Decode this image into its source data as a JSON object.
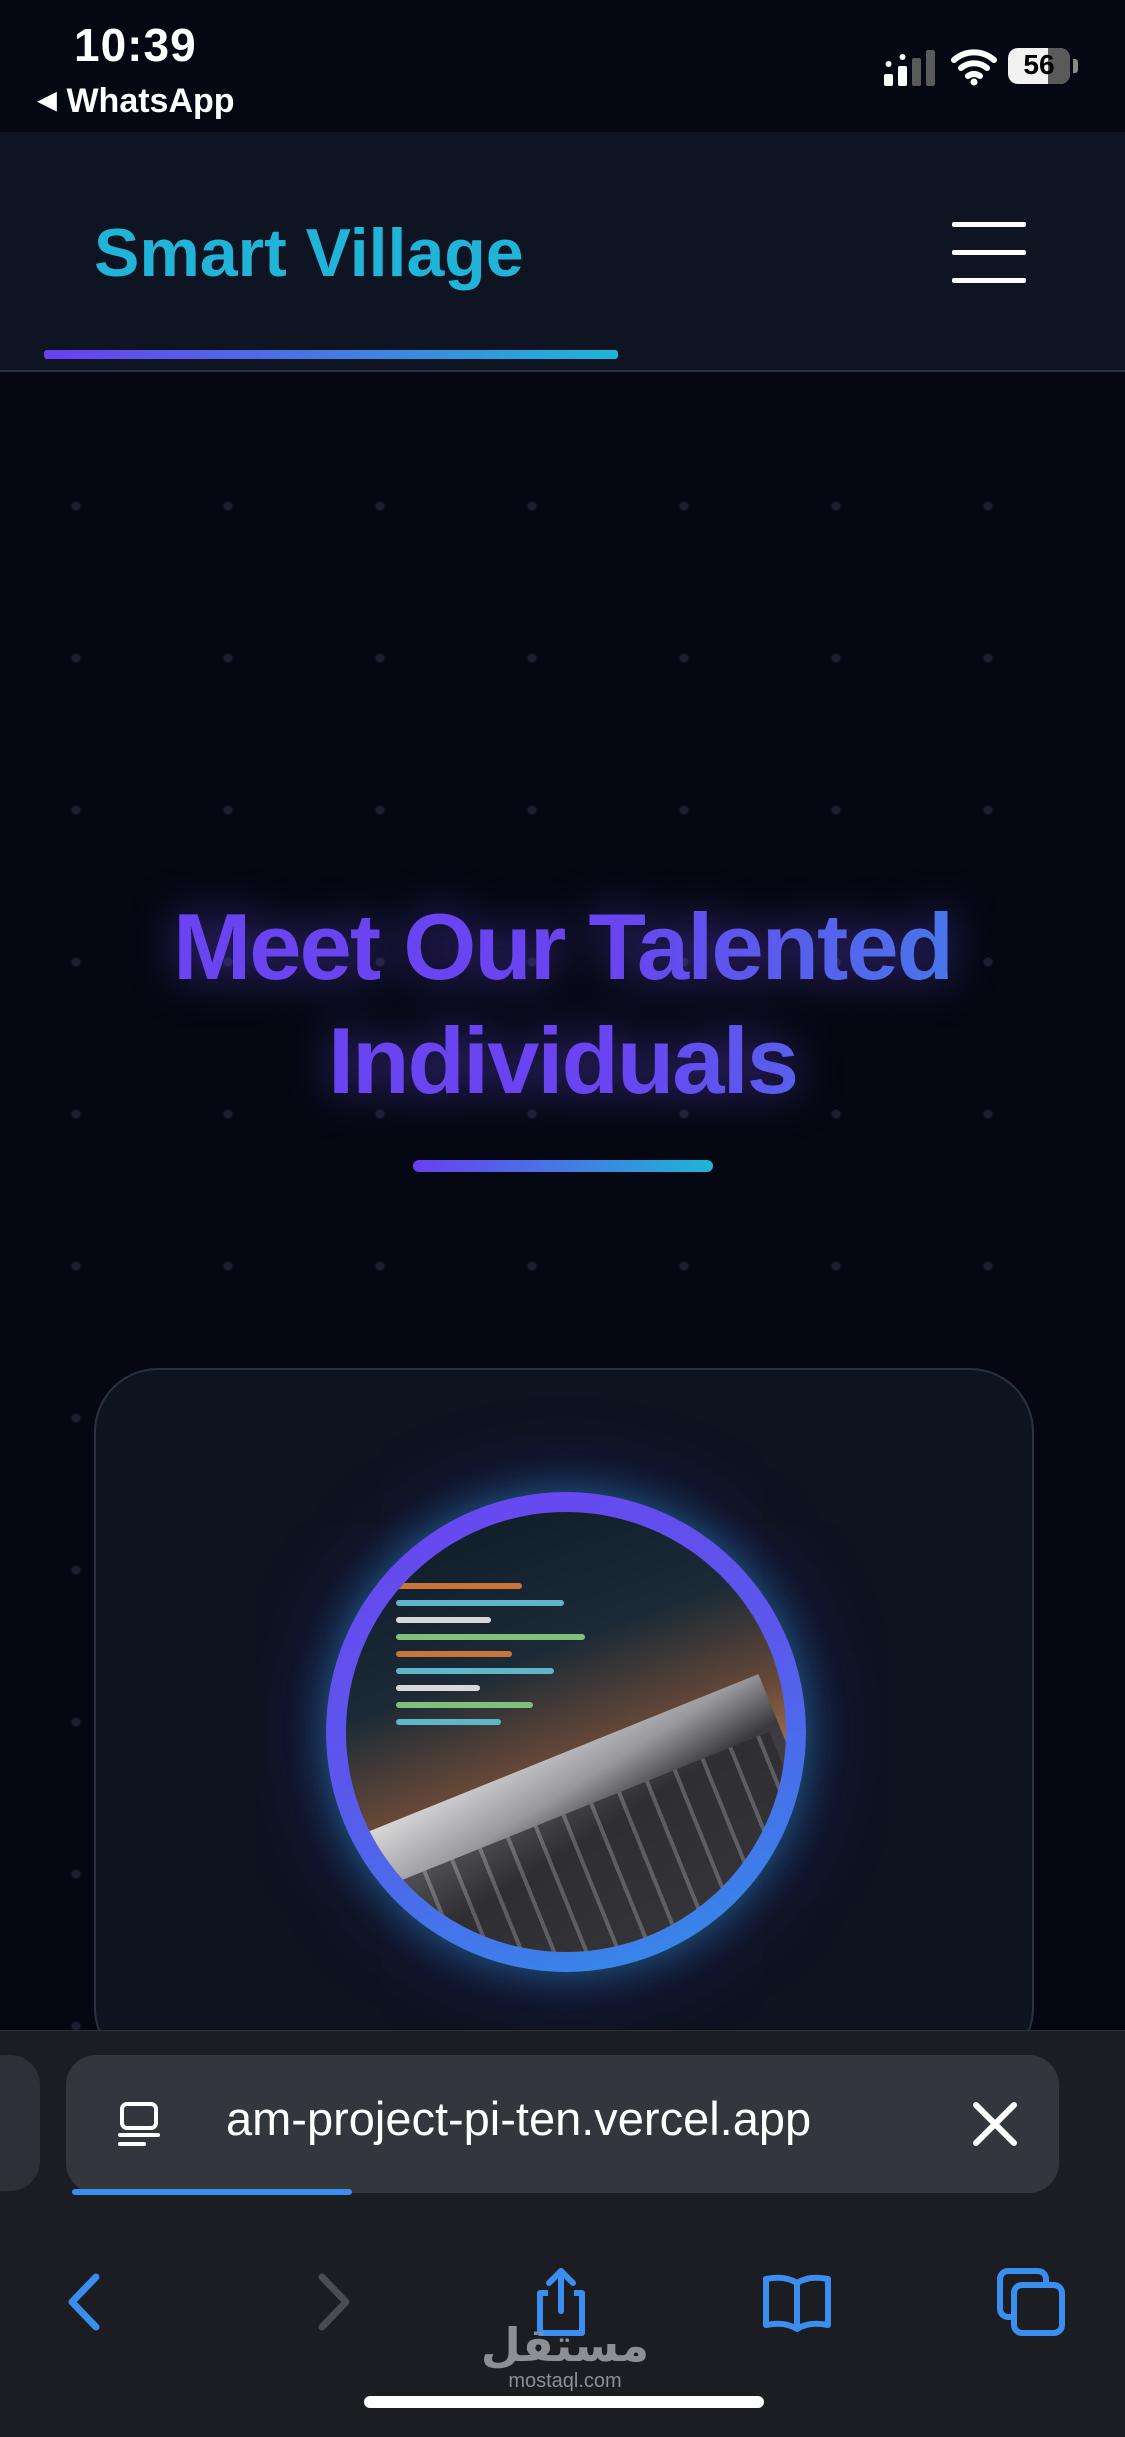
{
  "status_bar": {
    "time": "10:39",
    "back_app": "WhatsApp",
    "battery": "56",
    "icons": [
      "signal-icon",
      "wifi-icon",
      "battery-icon"
    ]
  },
  "nav": {
    "brand": "Smart Village",
    "menu_icon": "hamburger-menu-icon",
    "brand_color": "#1fb4d8",
    "accent_gradient": [
      "#6a3ff0",
      "#1eb5d6"
    ]
  },
  "hero": {
    "title": "Meet Our Talented Individuals",
    "title_color": "#6a44f0"
  },
  "card": {
    "avatar": "laptop-code-photo"
  },
  "browser": {
    "url": "team-project-pi-ten.vercel.app",
    "url_visible": "am-project-pi-ten.vercel.app",
    "progress_fraction": 0.28,
    "toolbar": [
      "back-icon",
      "forward-icon",
      "share-icon",
      "bookmarks-icon",
      "tabs-icon"
    ],
    "accent": "#3a8ef0"
  },
  "watermark": {
    "arabic": "مستقل",
    "latin": "mostaql.com"
  }
}
